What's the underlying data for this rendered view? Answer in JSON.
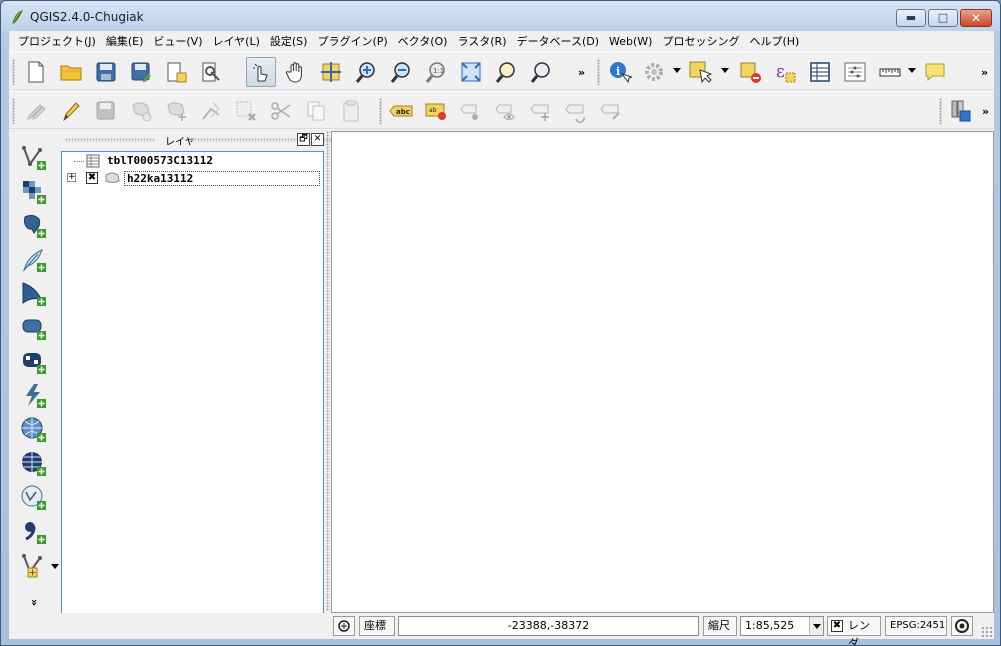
{
  "window": {
    "title": "QGIS2.4.0-Chugiak",
    "minimize_glyph": "▬",
    "maximize_glyph": "□",
    "close_glyph": "✕"
  },
  "menu": [
    "プロジェクト(J)",
    "編集(E)",
    "ビュー(V)",
    "レイヤ(L)",
    "設定(S)",
    "プラグイン(P)",
    "ベクタ(O)",
    "ラスタ(R)",
    "データベース(D)",
    "Web(W)",
    "プロセッシング",
    "ヘルプ(H)"
  ],
  "toolbar": {
    "overflow": "»",
    "label_badge": "abc",
    "label_badge_small": "ab"
  },
  "vtoolbar": {
    "overflow": "»"
  },
  "layers_panel": {
    "title": "レイヤ",
    "float_glyph": "🗗",
    "close_glyph": "✕",
    "layers": [
      {
        "name": "tblT000573C13112",
        "type": "table",
        "checked": null
      },
      {
        "name": "h22ka13112",
        "type": "polygon",
        "checked": true,
        "expand": "⊞"
      }
    ]
  },
  "statusbar": {
    "coord_label": "座標",
    "coord_value": "-23388,-38372",
    "scale_label": "縮尺",
    "scale_value": "1:85,525",
    "render_label": "レンダ",
    "render_checked": true,
    "crs": "EPSG:2451"
  },
  "colors": {
    "accent_blue": "#3399ff",
    "titlebar": "#c5d7ec"
  }
}
